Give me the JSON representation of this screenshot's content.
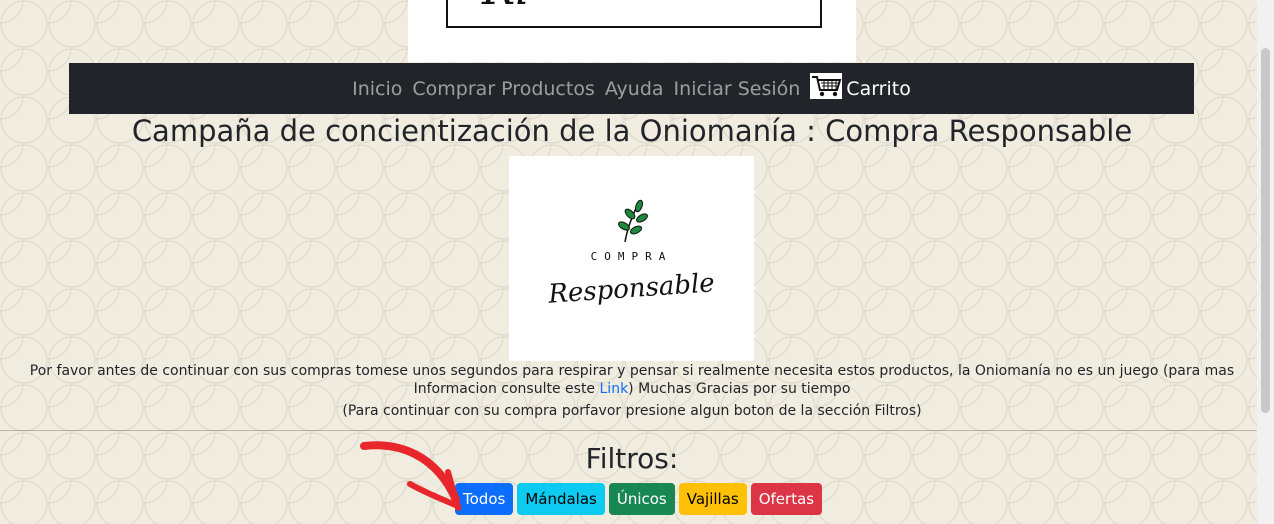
{
  "header": {
    "logo_text": "Ri"
  },
  "nav": {
    "items": [
      "Inicio",
      "Comprar Productos",
      "Ayuda",
      "Iniciar Sesión"
    ],
    "cart_icon": "cart-icon",
    "cart_label": "Carrito"
  },
  "main": {
    "title": "Campaña de concientización de la Oniomanía : Compra Responsable",
    "campaign_logo": {
      "icon": "leaf-branch-icon",
      "line1": "COMPRA",
      "line2": "Responsable"
    },
    "message_before_link": "Por favor antes de continuar con sus compras tomese unos segundos para respirar y pensar si realmente necesita estos productos, la Oniomanía no es un juego (para mas Informacion consulte este ",
    "message_link": "Link",
    "message_after_link": ") Muchas Gracias por su tiempo",
    "instruction": "(Para continuar con su compra porfavor presione algun boton de la sección Filtros)"
  },
  "filters": {
    "title": "Filtros:",
    "buttons": [
      {
        "label": "Todos",
        "color": "#0d6efd",
        "text_color": "#ffffff"
      },
      {
        "label": "Mándalas",
        "color": "#0dcaf0",
        "text_color": "#000000"
      },
      {
        "label": "Únicos",
        "color": "#198754",
        "text_color": "#ffffff"
      },
      {
        "label": "Vajillas",
        "color": "#ffc107",
        "text_color": "#000000"
      },
      {
        "label": "Ofertas",
        "color": "#dc3545",
        "text_color": "#ffffff"
      }
    ]
  },
  "annotation": {
    "icon": "red-arrow-icon",
    "color": "#e8262c"
  },
  "colors": {
    "navbar": "#212529",
    "background": "#f0ece0",
    "link": "#0d6efd"
  }
}
